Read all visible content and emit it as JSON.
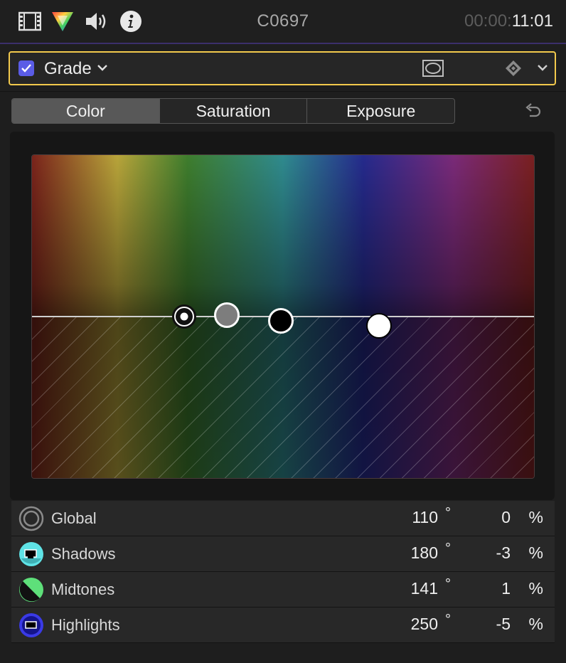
{
  "header": {
    "clip_name": "C0697",
    "timecode_dim": "00:00:",
    "timecode_bright": "11:01",
    "icons": [
      "film-icon",
      "color-wheel-icon",
      "audio-icon",
      "info-icon"
    ]
  },
  "effect": {
    "name": "Grade",
    "enabled": true,
    "icons": [
      "mask-icon",
      "keyframe-icon",
      "expand-chevron-icon"
    ]
  },
  "tabs": [
    {
      "label": "Color",
      "active": true
    },
    {
      "label": "Saturation",
      "active": false
    },
    {
      "label": "Exposure",
      "active": false
    }
  ],
  "rows": [
    {
      "label": "Global",
      "hue": "110",
      "deg": "°",
      "value": "0",
      "unit": "%",
      "icon": "global-ring-icon"
    },
    {
      "label": "Shadows",
      "hue": "180",
      "deg": "°",
      "value": "-3",
      "unit": "%",
      "icon": "shadows-icon",
      "color": "#5fe3e6"
    },
    {
      "label": "Midtones",
      "hue": "141",
      "deg": "°",
      "value": "1",
      "unit": "%",
      "icon": "midtones-icon",
      "color": "#5ee07a"
    },
    {
      "label": "Highlights",
      "hue": "250",
      "deg": "°",
      "value": "-5",
      "unit": "%",
      "icon": "highlights-icon",
      "color": "#3a3ae6"
    }
  ],
  "colors": {
    "accent": "#5a5ce6",
    "selection_border": "#f2c94c"
  }
}
